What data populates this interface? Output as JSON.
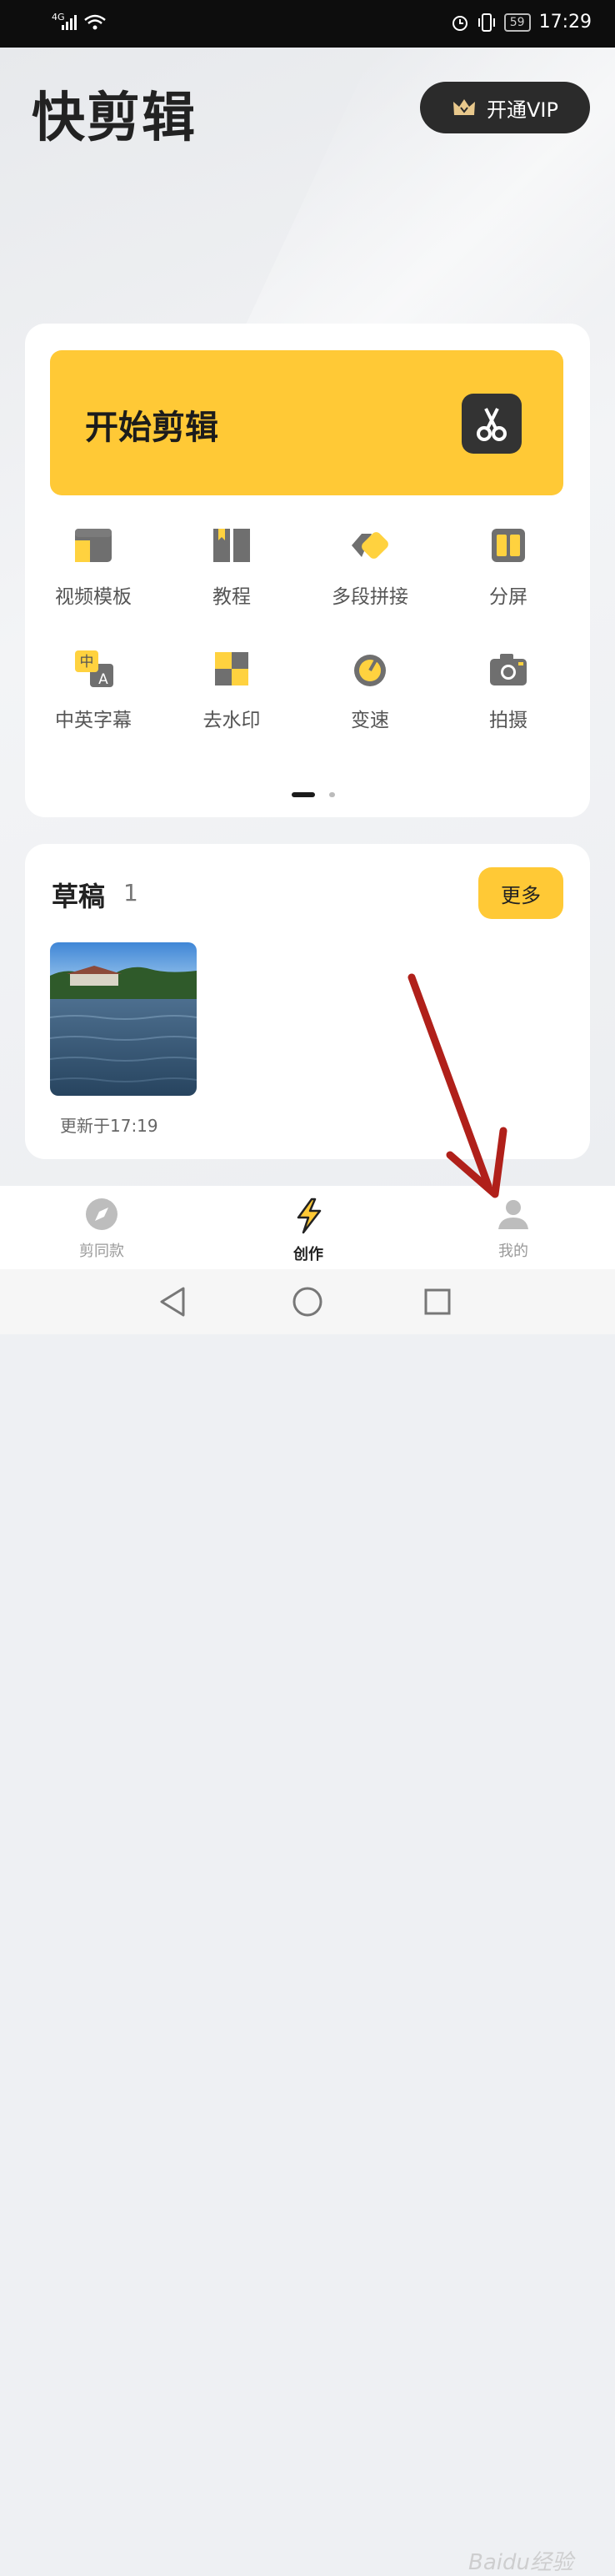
{
  "status_bar": {
    "signal": "4G",
    "time": "17:29",
    "battery": "59"
  },
  "header": {
    "app_title": "快剪辑",
    "vip_label": "开通VIP"
  },
  "main_card": {
    "start_label": "开始剪辑",
    "tools": [
      {
        "label": "视频模板",
        "icon": "video-template-icon"
      },
      {
        "label": "教程",
        "icon": "book-icon"
      },
      {
        "label": "多段拼接",
        "icon": "multi-segment-icon"
      },
      {
        "label": "分屏",
        "icon": "split-screen-icon"
      },
      {
        "label": "中英字幕",
        "icon": "subtitle-icon"
      },
      {
        "label": "去水印",
        "icon": "watermark-remove-icon"
      },
      {
        "label": "变速",
        "icon": "speed-icon"
      },
      {
        "label": "拍摄",
        "icon": "camera-icon"
      }
    ],
    "subtitle_icon_text": {
      "zh": "中",
      "en": "A"
    }
  },
  "drafts": {
    "title": "草稿",
    "count": "1",
    "more_label": "更多",
    "updated": "更新于17:19"
  },
  "tab_bar": {
    "tabs": [
      {
        "label": "剪同款",
        "icon": "compass-icon"
      },
      {
        "label": "创作",
        "icon": "lightning-icon"
      },
      {
        "label": "我的",
        "icon": "person-icon"
      }
    ]
  },
  "watermark": "Baidu经验",
  "colors": {
    "accent": "#ffc936",
    "dark": "#2b2b2b",
    "annotation_arrow": "#b0201a"
  }
}
